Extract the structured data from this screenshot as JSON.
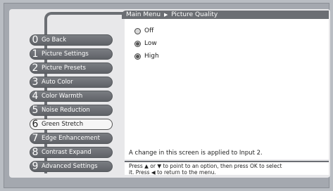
{
  "breadcrumb": {
    "root": "Main Menu",
    "separator": "▶",
    "current": "Picture Quality"
  },
  "menu": {
    "items": [
      {
        "num": "0",
        "label": "Go Back",
        "active": false
      },
      {
        "num": "1",
        "label": "Picture Settings",
        "active": false
      },
      {
        "num": "2",
        "label": "Picture Presets",
        "active": false
      },
      {
        "num": "3",
        "label": "Auto Color",
        "active": false
      },
      {
        "num": "4",
        "label": "Color Warmth",
        "active": false
      },
      {
        "num": "5",
        "label": "Noise Reduction",
        "active": false
      },
      {
        "num": "6",
        "label": "Green Stretch",
        "active": true
      },
      {
        "num": "7",
        "label": "Edge Enhancement",
        "active": false
      },
      {
        "num": "8",
        "label": "Contrast Expand",
        "active": false
      },
      {
        "num": "9",
        "label": "Advanced Settings",
        "active": false
      }
    ]
  },
  "options": [
    {
      "label": "Off",
      "selected": false
    },
    {
      "label": "Low",
      "selected": true
    },
    {
      "label": "High",
      "selected": true
    }
  ],
  "note": "A change in this screen is applied to Input 2.",
  "help": {
    "line1": "Press ▲ or ▼ to point to an option, then press OK to select",
    "line2": "it. Press ◀ to return to the menu."
  },
  "colors": {
    "menu_bg": "#6b6e73",
    "active_bg": "#f6f6f6",
    "panel_bg": "#e8e8ea"
  }
}
